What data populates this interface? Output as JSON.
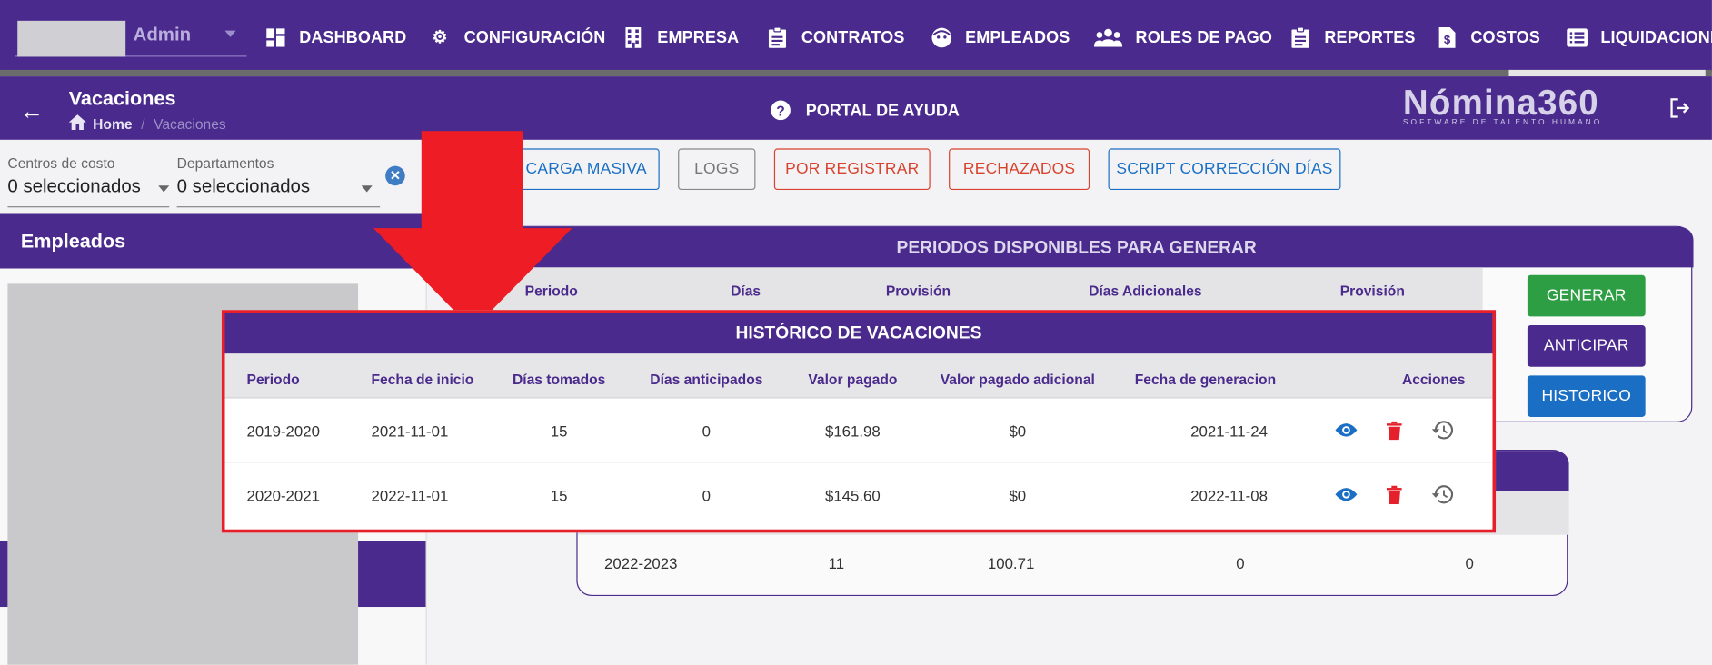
{
  "topnav": {
    "admin_label": "Admin",
    "items": [
      {
        "label": "DASHBOARD",
        "icon": "dashboard-icon"
      },
      {
        "label": "CONFIGURACIÓN",
        "icon": "gear-icon"
      },
      {
        "label": "EMPRESA",
        "icon": "building-icon"
      },
      {
        "label": "CONTRATOS",
        "icon": "clipboard-icon"
      },
      {
        "label": "EMPLEADOS",
        "icon": "face-icon"
      },
      {
        "label": "ROLES DE PAGO",
        "icon": "people-icon"
      },
      {
        "label": "REPORTES",
        "icon": "clipboard-icon"
      },
      {
        "label": "COSTOS",
        "icon": "dollar-file-icon"
      },
      {
        "label": "LIQUIDACIONES",
        "icon": "list-icon"
      }
    ]
  },
  "subbar": {
    "title": "Vacaciones",
    "breadcrumb_home": "Home",
    "breadcrumb_separator": "/",
    "breadcrumb_current": "Vacaciones",
    "help_label": "PORTAL DE AYUDA",
    "logo_text": "Nómina360",
    "logo_tagline": "SOFTWARE DE TALENTO HUMANO"
  },
  "filters": {
    "centros_label": "Centros de costo",
    "centros_value": "0 seleccionados",
    "departamentos_label": "Departamentos",
    "departamentos_value": "0 seleccionados"
  },
  "toolbar": {
    "carga_masiva": "CARGA MASIVA",
    "logs": "LOGS",
    "por_registrar": "POR REGISTRAR",
    "rechazados": "RECHAZADOS",
    "script": "SCRIPT CORRECCIÓN DÍAS"
  },
  "left_panel": {
    "title": "Empleados"
  },
  "periodos": {
    "title": "PERIODOS DISPONIBLES PARA GENERAR",
    "columns": [
      "Periodo",
      "Días",
      "Provisión",
      "Días Adicionales",
      "Provisión"
    ]
  },
  "actions": {
    "generar": "GENERAR",
    "anticipar": "ANTICIPAR",
    "historico": "HISTORICO"
  },
  "dias_table": {
    "row": [
      "2022-2023",
      "11",
      "100.71",
      "0",
      "0"
    ]
  },
  "historico": {
    "title": "HISTÓRICO DE VACACIONES",
    "columns": [
      "Periodo",
      "Fecha de inicio",
      "Días tomados",
      "Días anticipados",
      "Valor pagado",
      "Valor pagado adicional",
      "Fecha de generacion",
      "Acciones"
    ],
    "rows": [
      [
        "2019-2020",
        "2021-11-01",
        "15",
        "0",
        "$161.98",
        "$0",
        "2021-11-24"
      ],
      [
        "2020-2021",
        "2022-11-01",
        "15",
        "0",
        "$145.60",
        "$0",
        "2022-11-08"
      ]
    ],
    "row_action_icons": [
      "eye-icon",
      "trash-icon",
      "history-icon"
    ]
  },
  "colors": {
    "brand_purple": "#4a2a8c",
    "success_green": "#2e9e45",
    "info_blue": "#1a6fc4",
    "danger_red": "#e5202a",
    "outline_red": "#d9422e"
  }
}
